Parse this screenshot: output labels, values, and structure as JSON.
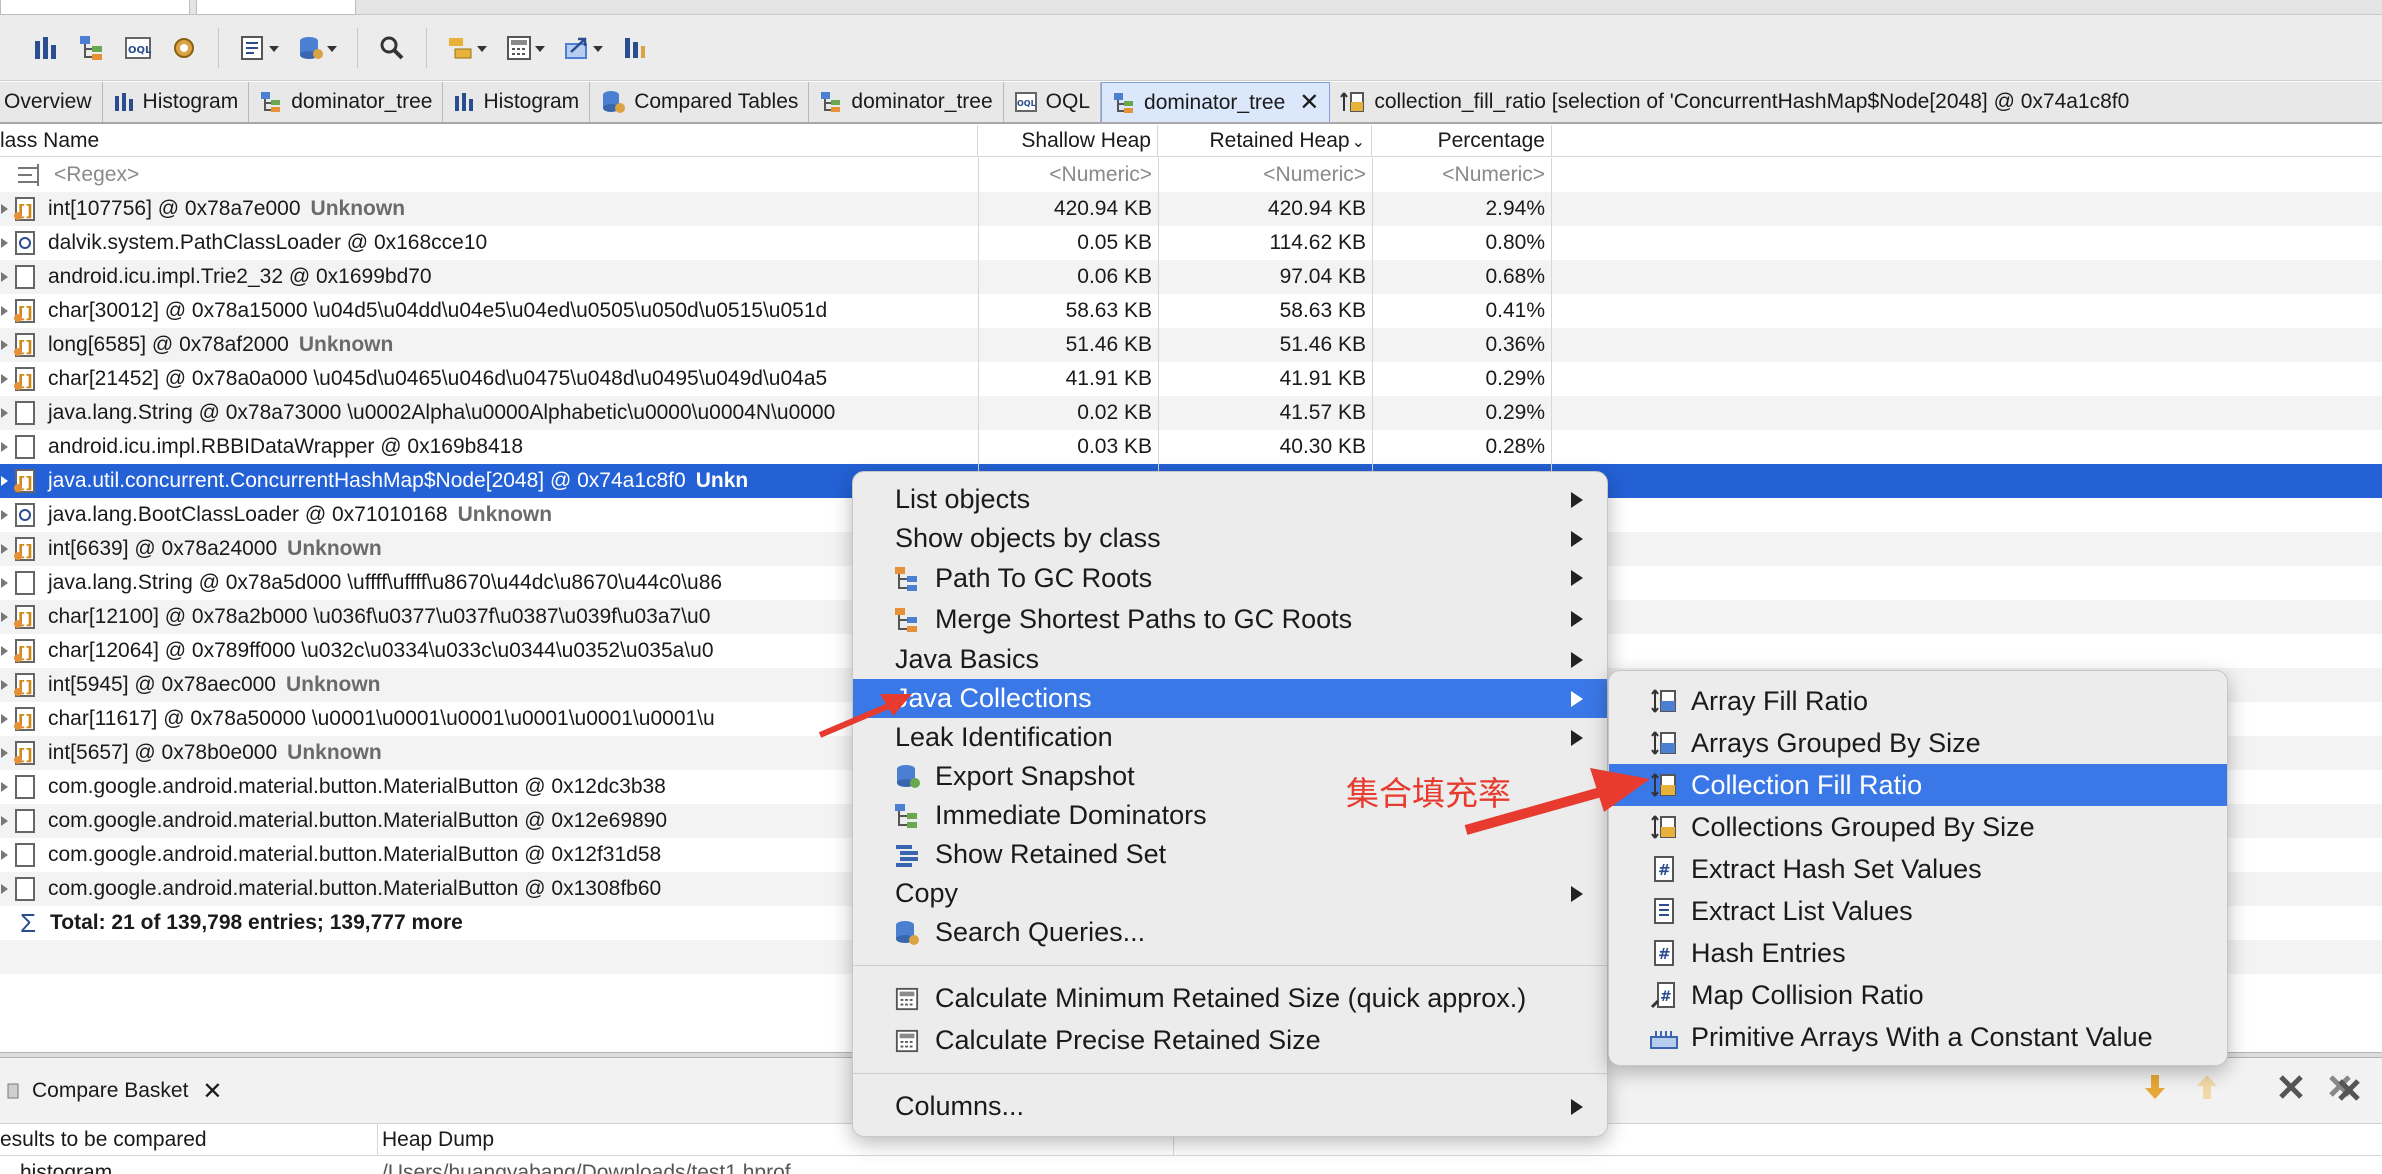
{
  "tabs": [
    {
      "label": "Overview",
      "icon": "info-icon"
    },
    {
      "label": "Histogram",
      "icon": "histogram-icon"
    },
    {
      "label": "dominator_tree",
      "icon": "dominator-tree-icon"
    },
    {
      "label": "Histogram",
      "icon": "histogram-icon"
    },
    {
      "label": "Compared Tables",
      "icon": "compare-tables-icon"
    },
    {
      "label": "dominator_tree",
      "icon": "dominator-tree-icon"
    },
    {
      "label": "OQL",
      "icon": "oql-icon"
    },
    {
      "label": "dominator_tree",
      "icon": "dominator-tree-icon",
      "active": true
    },
    {
      "label": "collection_fill_ratio  [selection of 'ConcurrentHashMap$Node[2048] @ 0x74a1c8f0",
      "icon": "query-result-icon"
    }
  ],
  "table": {
    "columns": [
      "lass Name",
      "Shallow Heap",
      "Retained Heap",
      "Percentage"
    ],
    "sort_indicator": "chevron-down",
    "filter": {
      "name": "<Regex>",
      "shallow": "<Numeric>",
      "retained": "<Numeric>",
      "percent": "<Numeric>"
    },
    "rows": [
      {
        "name": "int[107756] @ 0x78a7e000",
        "tag": "Unknown",
        "shallow": "420.94 KB",
        "retained": "420.94 KB",
        "percent": "2.94%"
      },
      {
        "name": "dalvik.system.PathClassLoader @ 0x168cce10",
        "tag": "",
        "shallow": "0.05 KB",
        "retained": "114.62 KB",
        "percent": "0.80%"
      },
      {
        "name": "android.icu.impl.Trie2_32 @ 0x1699bd70",
        "tag": "",
        "shallow": "0.06 KB",
        "retained": "97.04 KB",
        "percent": "0.68%"
      },
      {
        "name": "char[30012] @ 0x78a15000  \\u04d5\\u04dd\\u04e5\\u04ed\\u0505\\u050d\\u0515\\u051d",
        "tag": "",
        "shallow": "58.63 KB",
        "retained": "58.63 KB",
        "percent": "0.41%"
      },
      {
        "name": "long[6585] @ 0x78af2000",
        "tag": "Unknown",
        "shallow": "51.46 KB",
        "retained": "51.46 KB",
        "percent": "0.36%"
      },
      {
        "name": "char[21452] @ 0x78a0a000  \\u045d\\u0465\\u046d\\u0475\\u048d\\u0495\\u049d\\u04a5",
        "tag": "",
        "shallow": "41.91 KB",
        "retained": "41.91 KB",
        "percent": "0.29%"
      },
      {
        "name": "java.lang.String @ 0x78a73000  \\u0002Alpha\\u0000Alphabetic\\u0000\\u0004N\\u0000",
        "tag": "",
        "shallow": "0.02 KB",
        "retained": "41.57 KB",
        "percent": "0.29%"
      },
      {
        "name": "android.icu.impl.RBBIDataWrapper @ 0x169b8418",
        "tag": "",
        "shallow": "0.03 KB",
        "retained": "40.30 KB",
        "percent": "0.28%"
      },
      {
        "name": "java.util.concurrent.ConcurrentHashMap$Node[2048] @ 0x74a1c8f0",
        "tag": "Unkn",
        "shallow": "",
        "retained": "",
        "percent": "",
        "selected": true
      },
      {
        "name": "java.lang.BootClassLoader @ 0x71010168",
        "tag": "Unknown",
        "shallow": "",
        "retained": "",
        "percent": ""
      },
      {
        "name": "int[6639] @ 0x78a24000",
        "tag": "Unknown",
        "shallow": "",
        "retained": "",
        "percent": ""
      },
      {
        "name": "java.lang.String @ 0x78a5d000  \\uffff\\uffff\\u8670\\u44dc\\u8670\\u44c0\\u86",
        "tag": "",
        "shallow": "",
        "retained": "",
        "percent": ""
      },
      {
        "name": "char[12100] @ 0x78a2b000  \\u036f\\u0377\\u037f\\u0387\\u039f\\u03a7\\u0",
        "tag": "",
        "shallow": "",
        "retained": "",
        "percent": ""
      },
      {
        "name": "char[12064] @ 0x789ff000  \\u032c\\u0334\\u033c\\u0344\\u0352\\u035a\\u0",
        "tag": "",
        "shallow": "",
        "retained": "",
        "percent": ""
      },
      {
        "name": "int[5945] @ 0x78aec000",
        "tag": "Unknown",
        "shallow": "",
        "retained": "",
        "percent": ""
      },
      {
        "name": "char[11617] @ 0x78a50000  \\u0001\\u0001\\u0001\\u0001\\u0001\\u0001\\u",
        "tag": "",
        "shallow": "",
        "retained": "",
        "percent": ""
      },
      {
        "name": "int[5657] @ 0x78b0e000",
        "tag": "Unknown",
        "shallow": "",
        "retained": "",
        "percent": ""
      },
      {
        "name": "com.google.android.material.button.MaterialButton @ 0x12dc3b38",
        "tag": "",
        "shallow": "",
        "retained": "",
        "percent": ""
      },
      {
        "name": "com.google.android.material.button.MaterialButton @ 0x12e69890",
        "tag": "",
        "shallow": "",
        "retained": "",
        "percent": ""
      },
      {
        "name": "com.google.android.material.button.MaterialButton @ 0x12f31d58",
        "tag": "",
        "shallow": "",
        "retained": "",
        "percent": ""
      },
      {
        "name": "com.google.android.material.button.MaterialButton @ 0x1308fb60",
        "tag": "",
        "shallow": "",
        "retained": "",
        "percent": ""
      }
    ],
    "total": "Total: 21 of 139,798 entries; 139,777 more"
  },
  "context_menu": {
    "items": [
      {
        "label": "List objects",
        "submenu": true
      },
      {
        "label": "Show objects by class",
        "submenu": true
      },
      {
        "label": "Path To GC Roots",
        "submenu": true,
        "icon": "path-to-gc-roots-icon"
      },
      {
        "label": "Merge Shortest Paths to GC Roots",
        "submenu": true,
        "icon": "merge-paths-icon"
      },
      {
        "label": "Java Basics",
        "submenu": true
      },
      {
        "label": "Java Collections",
        "submenu": true,
        "highlighted": true
      },
      {
        "label": "Leak Identification",
        "submenu": true
      },
      {
        "label": "Export Snapshot",
        "submenu": false,
        "icon": "export-snapshot-icon"
      },
      {
        "label": "Immediate Dominators",
        "submenu": false,
        "icon": "immediate-dominators-icon"
      },
      {
        "label": "Show Retained Set",
        "submenu": false,
        "icon": "retained-set-icon"
      },
      {
        "label": "Copy",
        "submenu": true
      },
      {
        "label": "Search Queries...",
        "submenu": false,
        "icon": "search-queries-icon"
      }
    ],
    "calc_items": [
      {
        "label": "Calculate Minimum Retained Size (quick approx.)",
        "icon": "calculator-icon"
      },
      {
        "label": "Calculate Precise Retained Size",
        "icon": "calculator-icon"
      }
    ],
    "columns_item": {
      "label": "Columns...",
      "submenu": true
    }
  },
  "submenu": {
    "items": [
      {
        "label": "Array Fill Ratio",
        "icon": "array-fill-ratio-icon"
      },
      {
        "label": "Arrays Grouped By Size",
        "icon": "arrays-grouped-icon"
      },
      {
        "label": "Collection Fill Ratio",
        "icon": "collection-fill-ratio-icon",
        "highlighted": true
      },
      {
        "label": "Collections Grouped By Size",
        "icon": "collections-grouped-icon"
      },
      {
        "label": "Extract Hash Set Values",
        "icon": "hash-set-icon"
      },
      {
        "label": "Extract List Values",
        "icon": "list-values-icon"
      },
      {
        "label": "Hash Entries",
        "icon": "hash-entries-icon"
      },
      {
        "label": "Map Collision Ratio",
        "icon": "map-collision-icon"
      },
      {
        "label": "Primitive Arrays With a Constant Value",
        "icon": "primitive-arrays-icon"
      }
    ]
  },
  "annotation": "集合填充率",
  "compare_basket": {
    "tab_label": "Compare Basket",
    "columns": [
      "esults to be compared",
      "Heap Dump"
    ],
    "row": {
      "result": "histogram",
      "dump": "/Users/huangyabang/Downloads/test1.hprof"
    }
  },
  "colors": {
    "selection": "#2461d6",
    "menu_highlight": "#3b78e7",
    "annotation": "#e63b2e"
  }
}
